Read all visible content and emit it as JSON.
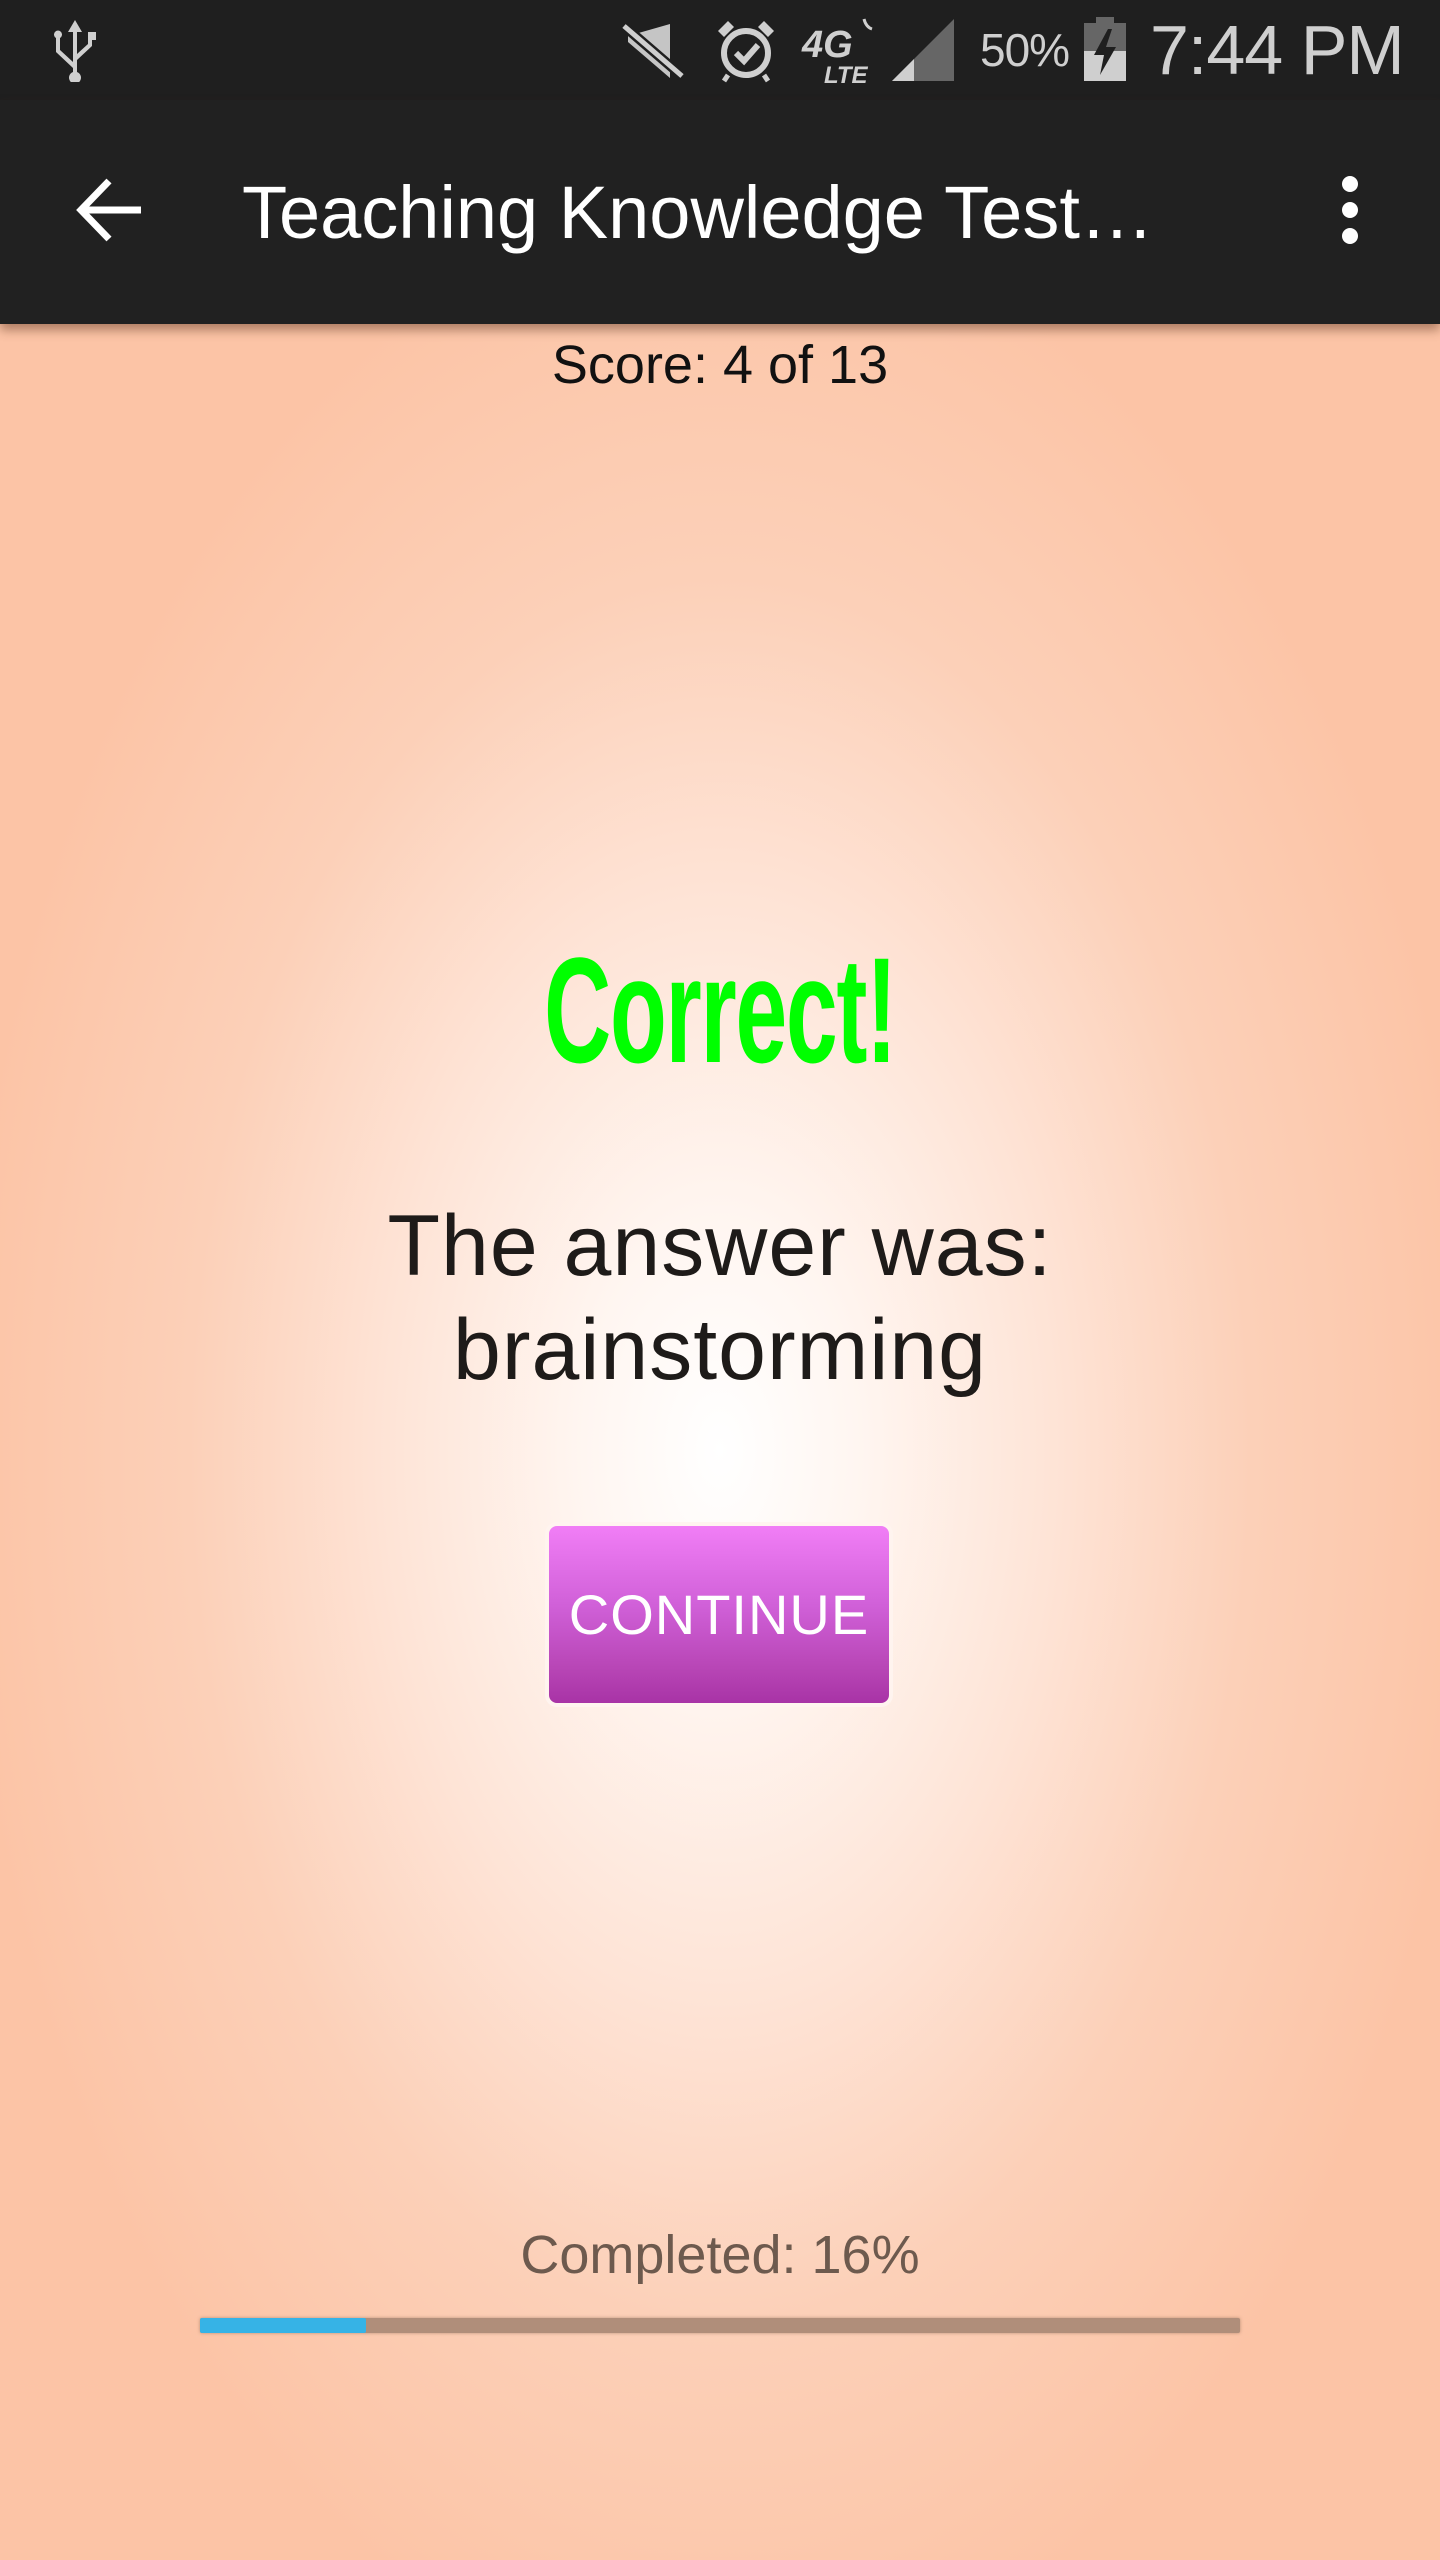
{
  "status_bar": {
    "icons": [
      "usb-icon",
      "mute-icon",
      "alarm-icon",
      "lte-icon",
      "signal-icon",
      "battery-charging-icon"
    ],
    "network_label": "4G LTE",
    "battery_percent": "50%",
    "time": "7:44 PM"
  },
  "app_bar": {
    "back_icon": "arrow-left-icon",
    "title": "Teaching Knowledge Test…",
    "overflow_icon": "more-vertical-icon"
  },
  "quiz": {
    "score_text": "Score: 4 of 13",
    "result_heading": "Correct!",
    "answer_intro": "The answer was:",
    "answer_value": "brainstorming",
    "continue_label": "CONTINUE",
    "completed_text": "Completed: 16%",
    "progress_percent": 16
  },
  "colors": {
    "correct_green": "#00ff00",
    "button_gradient_top": "#f17ef6",
    "button_gradient_bottom": "#a833a6",
    "progress_fill": "#36b3e6",
    "progress_track": "#b08e7a",
    "background_edge": "#fcc4a6",
    "app_bar": "#212121"
  }
}
